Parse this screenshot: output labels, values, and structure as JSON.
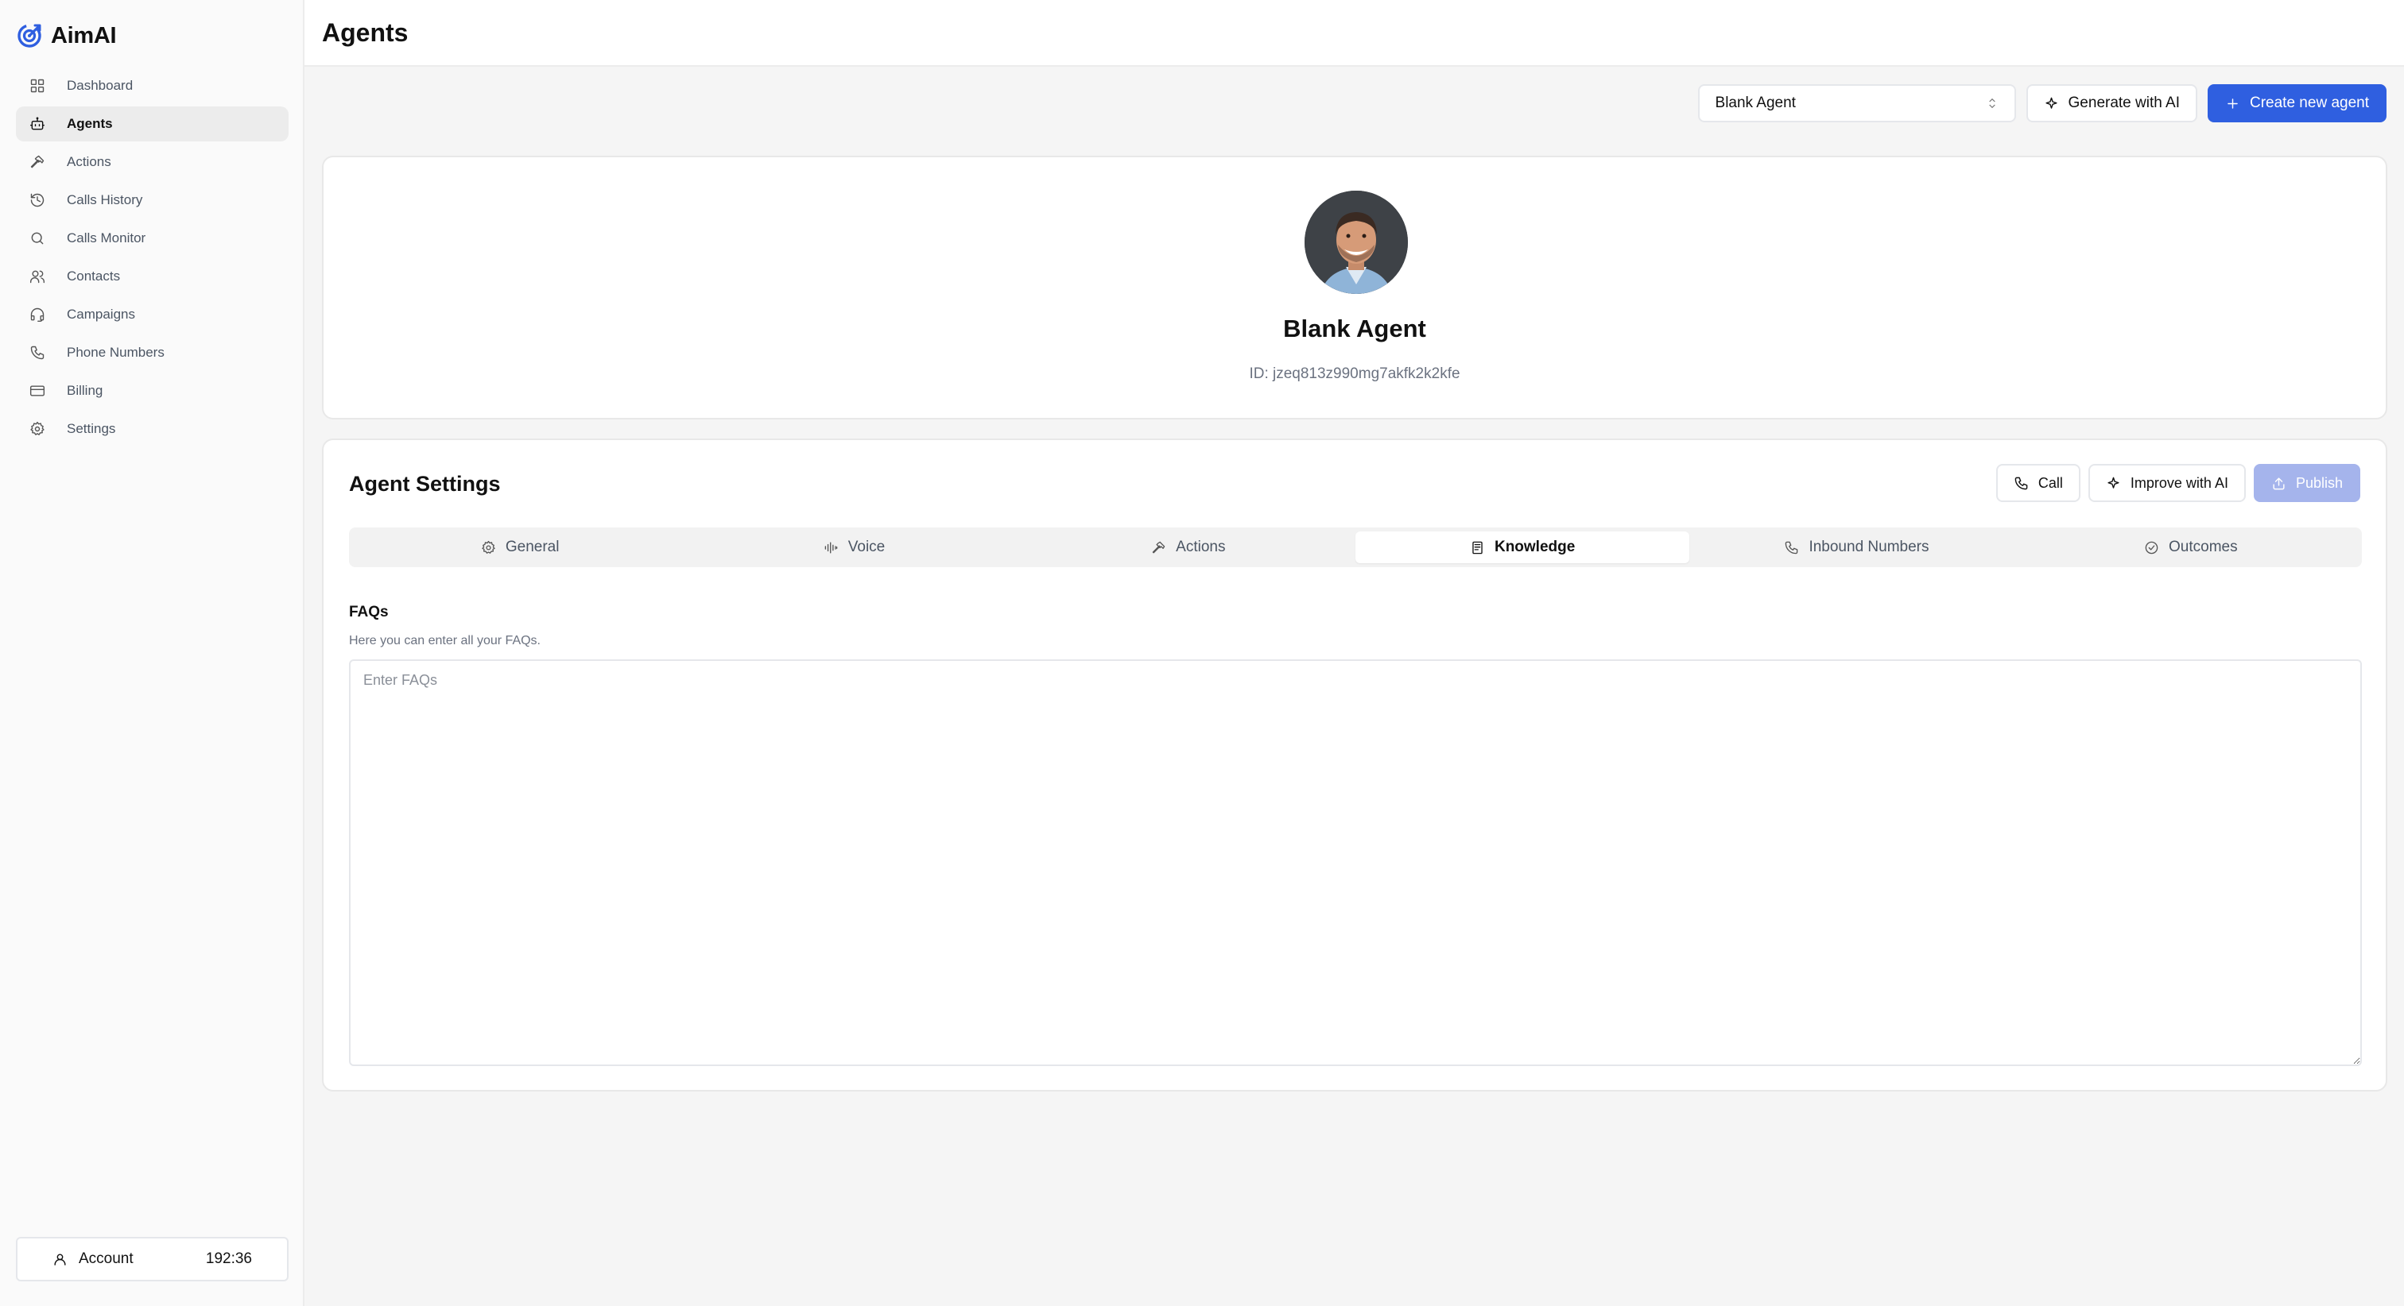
{
  "brand": {
    "name": "AimAI",
    "accent": "#2f5fe0"
  },
  "sidebar": {
    "items": [
      {
        "label": "Dashboard",
        "icon": "grid-icon",
        "active": false
      },
      {
        "label": "Agents",
        "icon": "bot-icon",
        "active": true
      },
      {
        "label": "Actions",
        "icon": "hammer-icon",
        "active": false
      },
      {
        "label": "Calls History",
        "icon": "history-icon",
        "active": false
      },
      {
        "label": "Calls Monitor",
        "icon": "search-icon",
        "active": false
      },
      {
        "label": "Contacts",
        "icon": "users-icon",
        "active": false
      },
      {
        "label": "Campaigns",
        "icon": "headset-icon",
        "active": false
      },
      {
        "label": "Phone Numbers",
        "icon": "phone-icon",
        "active": false
      },
      {
        "label": "Billing",
        "icon": "credit-card-icon",
        "active": false
      },
      {
        "label": "Settings",
        "icon": "gear-icon",
        "active": false
      }
    ],
    "account": {
      "label": "Account",
      "time": "192:36"
    }
  },
  "header": {
    "title": "Agents"
  },
  "toolbar": {
    "agent_select_value": "Blank Agent",
    "generate_label": "Generate with AI",
    "create_label": "Create new agent"
  },
  "profile": {
    "name": "Blank Agent",
    "id_text": "ID: jzeq813z990mg7akfk2k2kfe"
  },
  "settings": {
    "title": "Agent Settings",
    "call_label": "Call",
    "improve_label": "Improve with AI",
    "publish_label": "Publish",
    "tabs": [
      {
        "label": "General",
        "icon": "gear-icon",
        "active": false
      },
      {
        "label": "Voice",
        "icon": "audio-wave-icon",
        "active": false
      },
      {
        "label": "Actions",
        "icon": "hammer-icon",
        "active": false
      },
      {
        "label": "Knowledge",
        "icon": "book-icon",
        "active": true
      },
      {
        "label": "Inbound Numbers",
        "icon": "phone-icon",
        "active": false
      },
      {
        "label": "Outcomes",
        "icon": "check-circle-icon",
        "active": false
      }
    ],
    "faq": {
      "label": "FAQs",
      "help": "Here you can enter all your FAQs.",
      "placeholder": "Enter FAQs",
      "value": ""
    }
  }
}
